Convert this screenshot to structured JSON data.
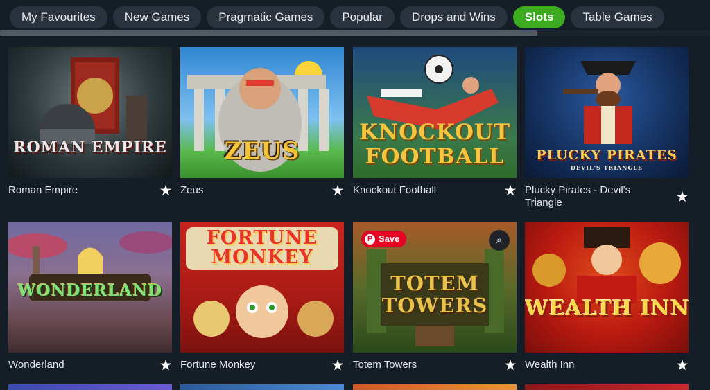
{
  "tabs": [
    {
      "label": "My Favourites"
    },
    {
      "label": "New Games"
    },
    {
      "label": "Pragmatic Games"
    },
    {
      "label": "Popular"
    },
    {
      "label": "Drops and Wins"
    },
    {
      "label": "Slots",
      "active": true
    },
    {
      "label": "Table Games"
    }
  ],
  "games": [
    {
      "title": "Roman Empire",
      "logo": "ROMAN EMPIRE"
    },
    {
      "title": "Zeus",
      "logo": "ZEUS"
    },
    {
      "title": "Knockout Football",
      "logo_line1": "KNOCKOUT",
      "logo_line2": "FOOTBALL"
    },
    {
      "title": "Plucky Pirates - Devil's Triangle",
      "logo": "PLUCKY PIRATES",
      "logo_sub": "DEVIL'S TRIANGLE"
    },
    {
      "title": "Wonderland",
      "logo": "WONDERLAND"
    },
    {
      "title": "Fortune Monkey",
      "logo_line1": "FORTUNE",
      "logo_line2": "MONKEY"
    },
    {
      "title": "Totem Towers",
      "logo_line1": "TOTEM",
      "logo_line2": "TOWERS"
    },
    {
      "title": "Wealth Inn",
      "logo": "WEALTH INN"
    }
  ],
  "overlay": {
    "save_label": "Save",
    "pin_icon_letter": "P"
  },
  "colors": {
    "accent": "#3cab20",
    "background": "#151d26",
    "tab_bg": "#2a333d",
    "pinterest": "#e60023"
  },
  "icons": {
    "favourite": "star-icon",
    "pinterest": "pinterest-icon",
    "visual_search": "lens-icon"
  }
}
